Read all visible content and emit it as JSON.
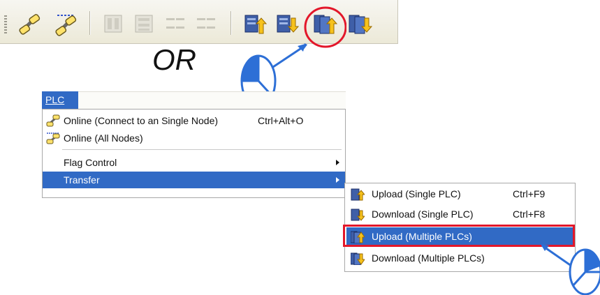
{
  "colors": {
    "menu_highlight": "#316ac5",
    "annotation_red": "#e3172a",
    "annotation_blue": "#2d6fd6"
  },
  "toolbar": {
    "buttons": [
      {
        "name": "online-single-node",
        "icon": "link-chain-icon",
        "enabled": true
      },
      {
        "name": "online-all-nodes",
        "icon": "link-chain-multi-icon",
        "enabled": true
      },
      {
        "name": "disabled-1",
        "icon": "grid-icon",
        "enabled": false
      },
      {
        "name": "disabled-2",
        "icon": "grid-icon",
        "enabled": false
      },
      {
        "name": "disabled-3",
        "icon": "text-grid-icon",
        "enabled": false
      },
      {
        "name": "disabled-4",
        "icon": "text-grid-icon",
        "enabled": false
      },
      {
        "name": "upload-single",
        "icon": "upload-icon",
        "enabled": true
      },
      {
        "name": "download-single",
        "icon": "download-icon",
        "enabled": true
      },
      {
        "name": "upload-multiple",
        "icon": "upload-multiple-icon",
        "enabled": true
      },
      {
        "name": "download-multiple",
        "icon": "download-multiple-icon",
        "enabled": true
      }
    ]
  },
  "or_label": "OR",
  "menu": {
    "title": "PLC",
    "items": [
      {
        "label": "Online (Connect to an Single Node)",
        "shortcut": "Ctrl+Alt+O",
        "icon": "link-chain-icon"
      },
      {
        "label": "Online (All Nodes)",
        "shortcut": "",
        "icon": "link-chain-multi-icon"
      },
      {
        "label": "Flag Control",
        "shortcut": "",
        "submenu": true
      },
      {
        "label": "Transfer",
        "shortcut": "",
        "submenu": true,
        "selected": true
      }
    ]
  },
  "submenu": {
    "items": [
      {
        "label": "Upload (Single PLC)",
        "shortcut": "Ctrl+F9",
        "icon": "upload-icon"
      },
      {
        "label": "Download (Single PLC)",
        "shortcut": "Ctrl+F8",
        "icon": "download-icon"
      },
      {
        "label": "Upload (Multiple PLCs)",
        "shortcut": "",
        "icon": "upload-multiple-icon",
        "selected": true
      },
      {
        "label": "Download (Multiple PLCs)",
        "shortcut": "",
        "icon": "download-multiple-icon"
      }
    ]
  }
}
